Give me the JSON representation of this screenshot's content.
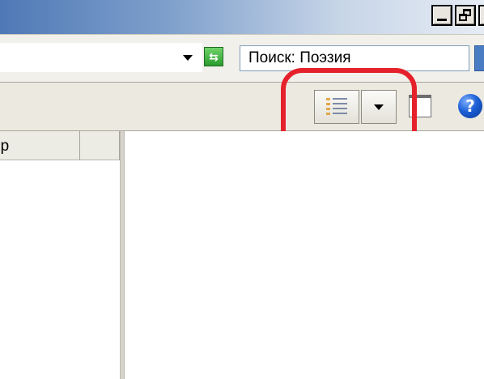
{
  "window": {
    "caption_buttons": [
      "minimize",
      "restore",
      "close"
    ]
  },
  "address_bar": {
    "search_value": "Поиск: Поэзия"
  },
  "toolbar": {
    "views_button": "views-list",
    "views_menu": "dropdown-arrow",
    "help_label": "?"
  },
  "list": {
    "columns": [
      "ер",
      ""
    ]
  },
  "annotation": {
    "highlight_color": "#e5212b"
  }
}
